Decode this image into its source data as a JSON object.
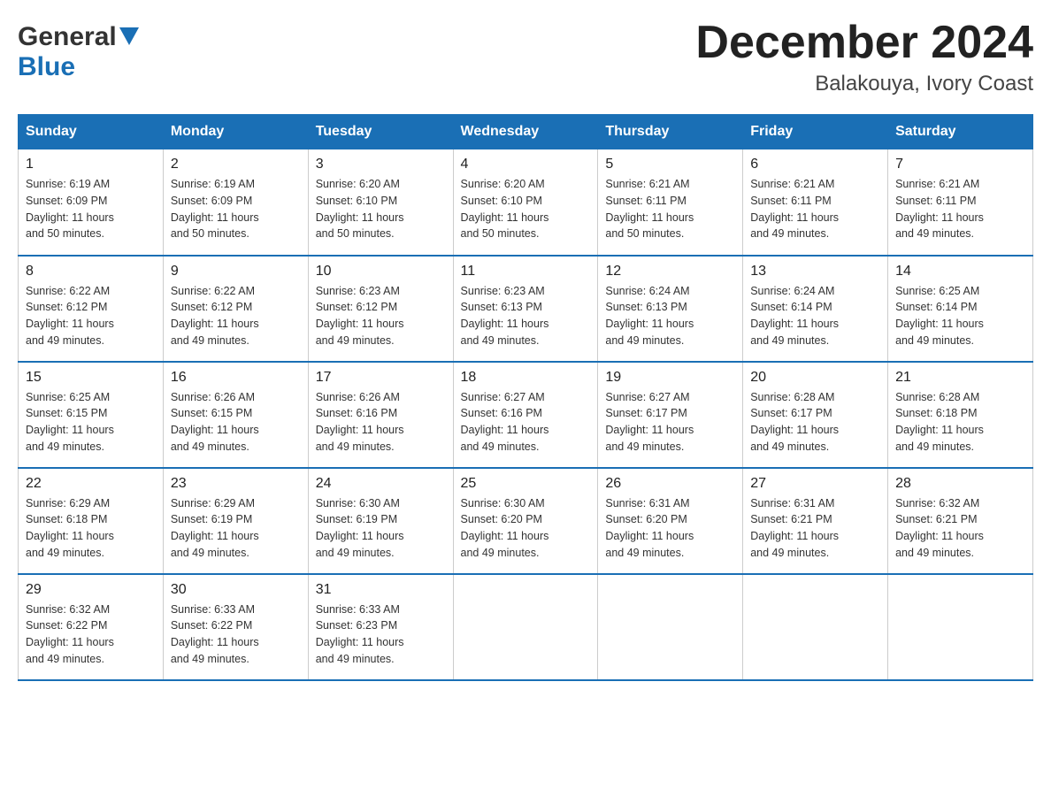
{
  "logo": {
    "general": "General",
    "blue": "Blue"
  },
  "title": {
    "month": "December 2024",
    "location": "Balakouya, Ivory Coast"
  },
  "days_of_week": [
    "Sunday",
    "Monday",
    "Tuesday",
    "Wednesday",
    "Thursday",
    "Friday",
    "Saturday"
  ],
  "weeks": [
    [
      {
        "day": "1",
        "sunrise": "6:19 AM",
        "sunset": "6:09 PM",
        "daylight": "11 hours and 50 minutes."
      },
      {
        "day": "2",
        "sunrise": "6:19 AM",
        "sunset": "6:09 PM",
        "daylight": "11 hours and 50 minutes."
      },
      {
        "day": "3",
        "sunrise": "6:20 AM",
        "sunset": "6:10 PM",
        "daylight": "11 hours and 50 minutes."
      },
      {
        "day": "4",
        "sunrise": "6:20 AM",
        "sunset": "6:10 PM",
        "daylight": "11 hours and 50 minutes."
      },
      {
        "day": "5",
        "sunrise": "6:21 AM",
        "sunset": "6:11 PM",
        "daylight": "11 hours and 50 minutes."
      },
      {
        "day": "6",
        "sunrise": "6:21 AM",
        "sunset": "6:11 PM",
        "daylight": "11 hours and 49 minutes."
      },
      {
        "day": "7",
        "sunrise": "6:21 AM",
        "sunset": "6:11 PM",
        "daylight": "11 hours and 49 minutes."
      }
    ],
    [
      {
        "day": "8",
        "sunrise": "6:22 AM",
        "sunset": "6:12 PM",
        "daylight": "11 hours and 49 minutes."
      },
      {
        "day": "9",
        "sunrise": "6:22 AM",
        "sunset": "6:12 PM",
        "daylight": "11 hours and 49 minutes."
      },
      {
        "day": "10",
        "sunrise": "6:23 AM",
        "sunset": "6:12 PM",
        "daylight": "11 hours and 49 minutes."
      },
      {
        "day": "11",
        "sunrise": "6:23 AM",
        "sunset": "6:13 PM",
        "daylight": "11 hours and 49 minutes."
      },
      {
        "day": "12",
        "sunrise": "6:24 AM",
        "sunset": "6:13 PM",
        "daylight": "11 hours and 49 minutes."
      },
      {
        "day": "13",
        "sunrise": "6:24 AM",
        "sunset": "6:14 PM",
        "daylight": "11 hours and 49 minutes."
      },
      {
        "day": "14",
        "sunrise": "6:25 AM",
        "sunset": "6:14 PM",
        "daylight": "11 hours and 49 minutes."
      }
    ],
    [
      {
        "day": "15",
        "sunrise": "6:25 AM",
        "sunset": "6:15 PM",
        "daylight": "11 hours and 49 minutes."
      },
      {
        "day": "16",
        "sunrise": "6:26 AM",
        "sunset": "6:15 PM",
        "daylight": "11 hours and 49 minutes."
      },
      {
        "day": "17",
        "sunrise": "6:26 AM",
        "sunset": "6:16 PM",
        "daylight": "11 hours and 49 minutes."
      },
      {
        "day": "18",
        "sunrise": "6:27 AM",
        "sunset": "6:16 PM",
        "daylight": "11 hours and 49 minutes."
      },
      {
        "day": "19",
        "sunrise": "6:27 AM",
        "sunset": "6:17 PM",
        "daylight": "11 hours and 49 minutes."
      },
      {
        "day": "20",
        "sunrise": "6:28 AM",
        "sunset": "6:17 PM",
        "daylight": "11 hours and 49 minutes."
      },
      {
        "day": "21",
        "sunrise": "6:28 AM",
        "sunset": "6:18 PM",
        "daylight": "11 hours and 49 minutes."
      }
    ],
    [
      {
        "day": "22",
        "sunrise": "6:29 AM",
        "sunset": "6:18 PM",
        "daylight": "11 hours and 49 minutes."
      },
      {
        "day": "23",
        "sunrise": "6:29 AM",
        "sunset": "6:19 PM",
        "daylight": "11 hours and 49 minutes."
      },
      {
        "day": "24",
        "sunrise": "6:30 AM",
        "sunset": "6:19 PM",
        "daylight": "11 hours and 49 minutes."
      },
      {
        "day": "25",
        "sunrise": "6:30 AM",
        "sunset": "6:20 PM",
        "daylight": "11 hours and 49 minutes."
      },
      {
        "day": "26",
        "sunrise": "6:31 AM",
        "sunset": "6:20 PM",
        "daylight": "11 hours and 49 minutes."
      },
      {
        "day": "27",
        "sunrise": "6:31 AM",
        "sunset": "6:21 PM",
        "daylight": "11 hours and 49 minutes."
      },
      {
        "day": "28",
        "sunrise": "6:32 AM",
        "sunset": "6:21 PM",
        "daylight": "11 hours and 49 minutes."
      }
    ],
    [
      {
        "day": "29",
        "sunrise": "6:32 AM",
        "sunset": "6:22 PM",
        "daylight": "11 hours and 49 minutes."
      },
      {
        "day": "30",
        "sunrise": "6:33 AM",
        "sunset": "6:22 PM",
        "daylight": "11 hours and 49 minutes."
      },
      {
        "day": "31",
        "sunrise": "6:33 AM",
        "sunset": "6:23 PM",
        "daylight": "11 hours and 49 minutes."
      },
      null,
      null,
      null,
      null
    ]
  ],
  "labels": {
    "sunrise": "Sunrise:",
    "sunset": "Sunset:",
    "daylight": "Daylight:"
  }
}
